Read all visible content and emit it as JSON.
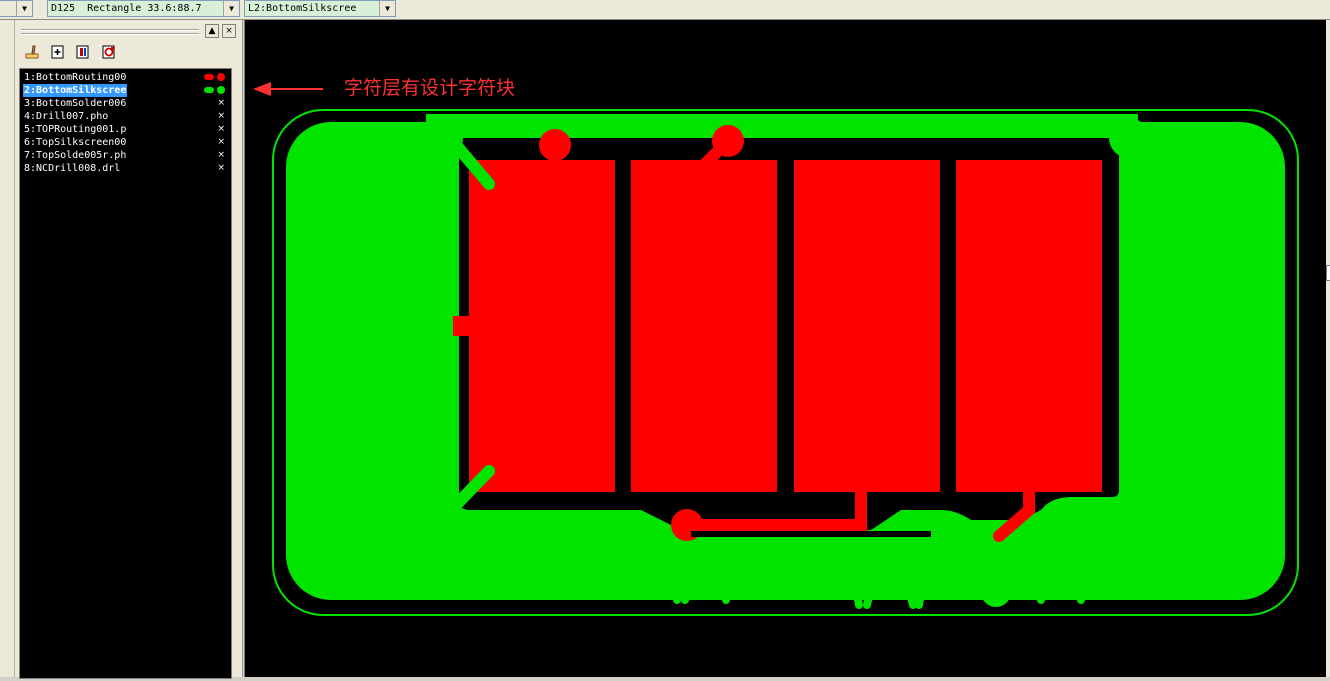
{
  "toolbar": {
    "aperture_select": "D125  Rectangle 33.6:88.7",
    "layer_select": "L2:BottomSilkscree",
    "dropdown_arrow": "▼"
  },
  "panel": {
    "min_button": "▲",
    "close_button": "×",
    "tools": [
      "clear-layer-icon",
      "add-layer-icon",
      "layer-properties-icon",
      "layer-reload-icon"
    ],
    "layers": [
      {
        "label": "1:BottomRouting00",
        "state": "visible",
        "color": "#ff0000"
      },
      {
        "label": "2:BottomSilkscree",
        "state": "selected",
        "color": "#00e400"
      },
      {
        "label": "3:BottomSolder006",
        "state": "hidden",
        "mark": "×"
      },
      {
        "label": "4:Drill007.pho",
        "state": "hidden",
        "mark": "×"
      },
      {
        "label": "5:TOPRouting001.p",
        "state": "hidden",
        "mark": "×"
      },
      {
        "label": "6:TopSilkscreen00",
        "state": "hidden",
        "mark": "×"
      },
      {
        "label": "7:TopSolde005r.ph",
        "state": "hidden",
        "mark": "×"
      },
      {
        "label": "8:NCDrill008.drl",
        "state": "hidden",
        "mark": "×"
      }
    ]
  },
  "annotation": {
    "text": "字符层有设计字符块",
    "color": "#ff3030"
  },
  "board": {
    "silk_color": "#00e400",
    "copper_color": "#ff0000",
    "background": "#000000"
  }
}
